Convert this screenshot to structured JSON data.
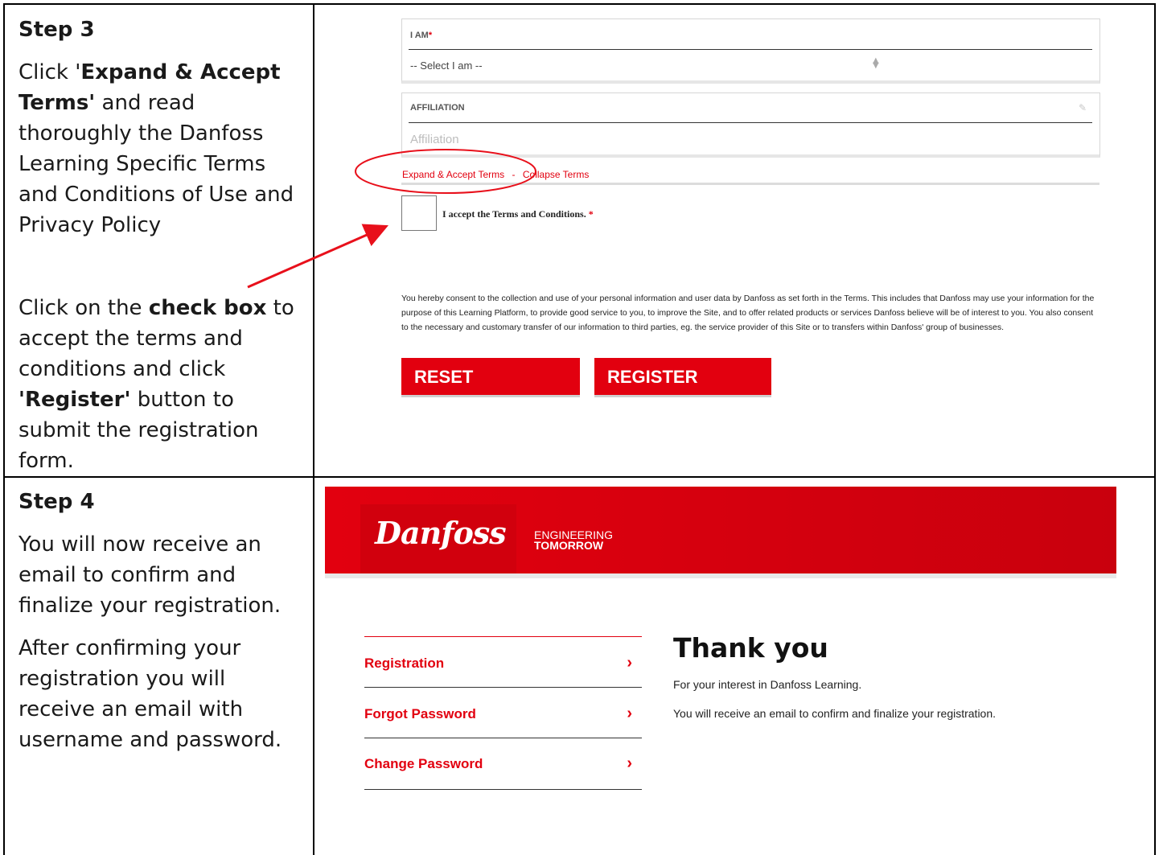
{
  "step3": {
    "heading": "Step 3",
    "para1_pre": "Click '",
    "para1_bold": "Expand & Accept Terms'",
    "para1_post": " and read thoroughly the Danfoss Learning Specific Terms and Conditions of Use and Privacy Policy",
    "para2_pre": "Click on the ",
    "para2_bold": "check box",
    "para2_mid": " to accept the terms and conditions and click ",
    "para2_bold2": "'Register'",
    "para2_post": " button to submit the registration form."
  },
  "form": {
    "i_am_label": "I AM",
    "required_mark": "*",
    "select_value": "-- Select I am --",
    "affiliation_label": "AFFILIATION",
    "affiliation_placeholder": "Affiliation",
    "expand_terms": "Expand & Accept Terms",
    "separator": "-",
    "collapse_terms": "Collapse Terms",
    "accept_label": "I accept the Terms and Conditions.",
    "consent": "You hereby consent to the collection and use of your personal information and user data by Danfoss as set forth in the Terms. This includes that Danfoss may use your information for the purpose of this Learning Platform, to provide good service to you, to improve the Site, and to offer related products or services Danfoss believe will be of interest to you. You also consent to the necessary and customary transfer of our information to third parties, eg. the service provider of this Site or to transfers within Danfoss' group of businesses.",
    "reset_label": "RESET",
    "register_label": "REGISTER"
  },
  "step4": {
    "heading": "Step 4",
    "para1": "You will now receive an email to confirm and finalize your registration.",
    "para2": "After confirming your registration you will receive an email with username and password."
  },
  "site": {
    "logo_text": "Danfoss",
    "tagline_line1": "ENGINEERING",
    "tagline_line2": "TOMORROW",
    "menu": [
      "Registration",
      "Forgot Password",
      "Change Password"
    ],
    "chevron": "›",
    "thank_title": "Thank you",
    "thank_line1": "For your interest in Danfoss Learning.",
    "thank_line2": "You will receive an email to confirm and finalize your registration."
  },
  "colors": {
    "brand_red": "#e2000f",
    "annotation_red": "#e8101b"
  }
}
